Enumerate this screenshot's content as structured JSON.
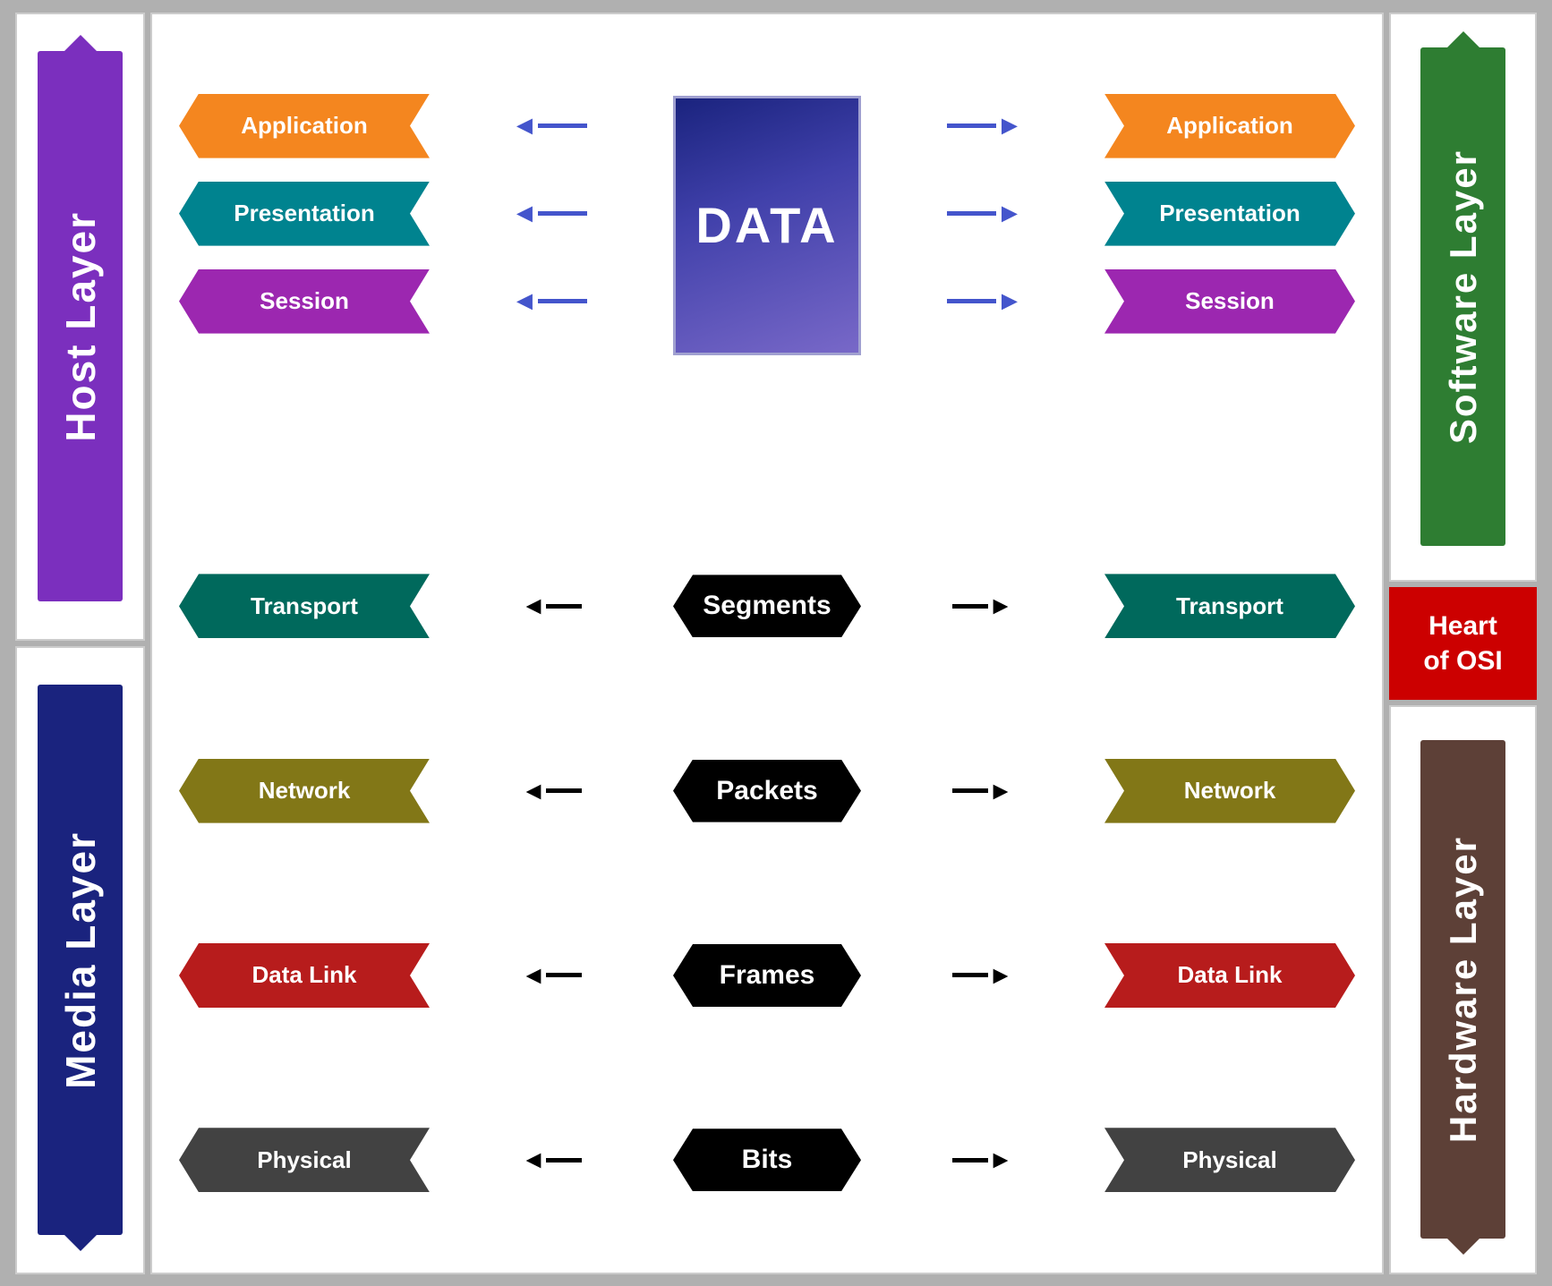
{
  "leftSidebar": {
    "hostLayer": "Host Layer",
    "mediaLayer": "Media Layer"
  },
  "rightSidebar": {
    "softwareLayer": "Software Layer",
    "heartOfOsi": "Heart\nof OSI",
    "hardwareLayer": "Hardware Layer"
  },
  "layers": [
    {
      "name": "Application",
      "color": "#f4861f",
      "dataUnit": "DATA",
      "isTop": true,
      "arrowColor": "blue",
      "row": 0
    },
    {
      "name": "Presentation",
      "color": "#00838f",
      "dataUnit": "DATA",
      "isTop": true,
      "arrowColor": "blue",
      "row": 1
    },
    {
      "name": "Session",
      "color": "#9c27b0",
      "dataUnit": "DATA",
      "isTop": true,
      "arrowColor": "blue",
      "row": 2
    },
    {
      "name": "Transport",
      "color": "#00695c",
      "dataUnit": "Segments",
      "isTop": false,
      "arrowColor": "black",
      "row": 3
    },
    {
      "name": "Network",
      "color": "#827717",
      "dataUnit": "Packets",
      "isTop": false,
      "arrowColor": "black",
      "row": 4
    },
    {
      "name": "Data Link",
      "color": "#b71c1c",
      "dataUnit": "Frames",
      "isTop": false,
      "arrowColor": "black",
      "row": 5
    },
    {
      "name": "Physical",
      "color": "#424242",
      "dataUnit": "Bits",
      "isTop": false,
      "arrowColor": "black",
      "row": 6
    }
  ],
  "centerLabel": "DATA",
  "colors": {
    "host": "#7b2fbe",
    "media": "#1a237e",
    "software": "#2e7d32",
    "hardware": "#5d4037",
    "heartOfOsi": "#cc0000"
  }
}
